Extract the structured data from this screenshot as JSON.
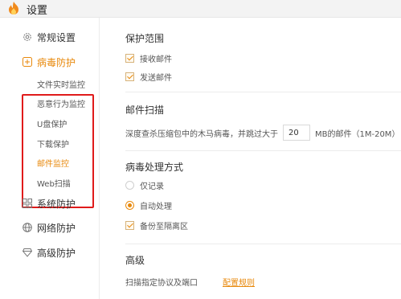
{
  "window": {
    "title": "设置"
  },
  "sidebar": {
    "items": [
      {
        "label": "常规设置",
        "icon": "gear-icon"
      },
      {
        "label": "病毒防护",
        "icon": "plus-square-icon",
        "active": true
      },
      {
        "label": "系统防护",
        "icon": "grid-icon"
      },
      {
        "label": "网络防护",
        "icon": "globe-icon"
      },
      {
        "label": "高级防护",
        "icon": "diamond-icon"
      }
    ],
    "sub_items": [
      {
        "label": "文件实时监控"
      },
      {
        "label": "恶意行为监控"
      },
      {
        "label": "U盘保护"
      },
      {
        "label": "下载保护"
      },
      {
        "label": "邮件监控",
        "active": true
      },
      {
        "label": "Web扫描"
      }
    ]
  },
  "main": {
    "protect_scope": {
      "title": "保护范围",
      "options": [
        {
          "label": "接收邮件",
          "checked": true
        },
        {
          "label": "发送邮件",
          "checked": true
        }
      ]
    },
    "mail_scan": {
      "title": "邮件扫描",
      "text_before": "深度查杀压缩包中的木马病毒，并跳过大于",
      "value": "20",
      "text_after": "MB的邮件（1M-20M）"
    },
    "virus_handling": {
      "title": "病毒处理方式",
      "options": [
        {
          "label": "仅记录",
          "checked": false
        },
        {
          "label": "自动处理",
          "checked": true
        }
      ],
      "backup": {
        "label": "备份至隔离区",
        "checked": true
      }
    },
    "advanced": {
      "title": "高级",
      "text": "扫描指定协议及端口",
      "link": "配置规则"
    }
  },
  "colors": {
    "accent": "#e8890c",
    "highlight_box": "#e01b1b"
  }
}
